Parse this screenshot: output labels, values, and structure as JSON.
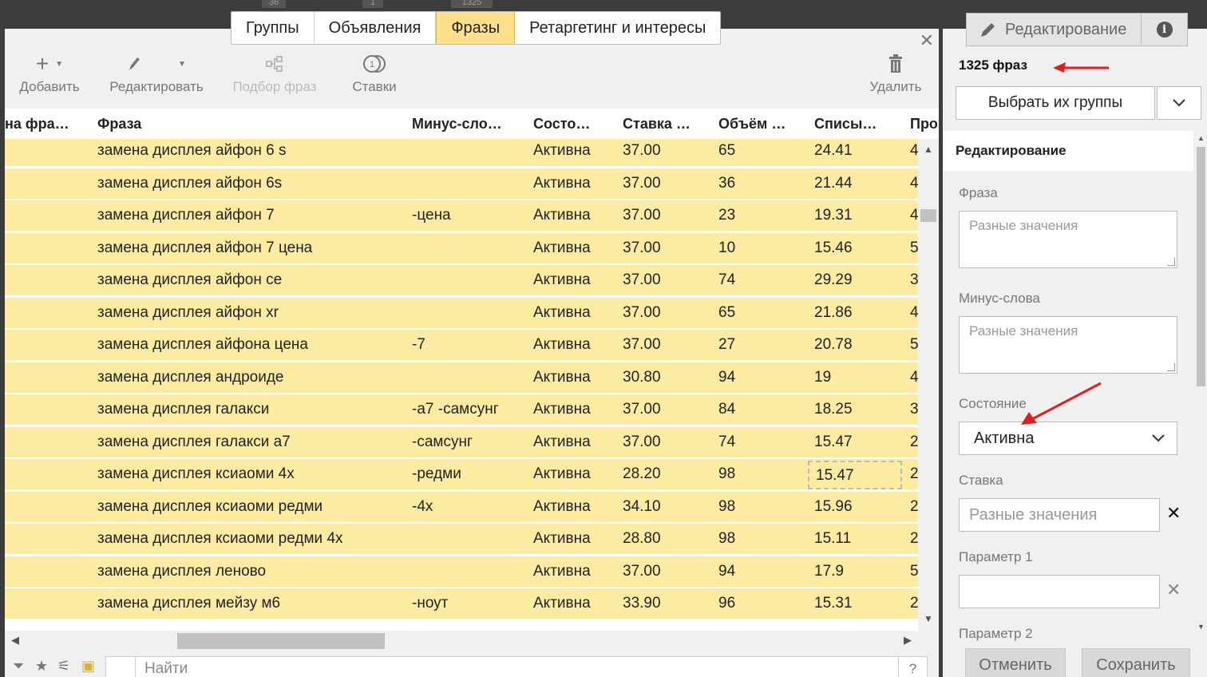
{
  "top_badges": [
    "36",
    "1",
    "1325"
  ],
  "tabs": [
    {
      "label": "Группы",
      "active": false
    },
    {
      "label": "Объявления",
      "active": false
    },
    {
      "label": "Фразы",
      "active": true
    },
    {
      "label": "Ретаргетинг и интересы",
      "active": false
    }
  ],
  "toolbar": {
    "add": "Добавить",
    "edit": "Редактировать",
    "pick": "Подбор фраз",
    "bids": "Ставки",
    "delete": "Удалить",
    "bids_icon_text": "1"
  },
  "columns": [
    "на фра…",
    "Фраза",
    "Минус-сло…",
    "Состо…",
    "Ставка …",
    "Объём …",
    "Списы…",
    "Про"
  ],
  "rows": [
    {
      "phrase": "замена дисплея айфон 6 s",
      "minus": "",
      "state": "Активна",
      "bid": "37.00",
      "volume": "65",
      "charge": "24.41",
      "extra": "4"
    },
    {
      "phrase": "замена дисплея айфон 6s",
      "minus": "",
      "state": "Активна",
      "bid": "37.00",
      "volume": "36",
      "charge": "21.44",
      "extra": "4"
    },
    {
      "phrase": "замена дисплея айфон 7",
      "minus": "-цена",
      "state": "Активна",
      "bid": "37.00",
      "volume": "23",
      "charge": "19.31",
      "extra": "4"
    },
    {
      "phrase": "замена дисплея айфон 7 цена",
      "minus": "",
      "state": "Активна",
      "bid": "37.00",
      "volume": "10",
      "charge": "15.46",
      "extra": "5"
    },
    {
      "phrase": "замена дисплея айфон се",
      "minus": "",
      "state": "Активна",
      "bid": "37.00",
      "volume": "74",
      "charge": "29.29",
      "extra": "3"
    },
    {
      "phrase": "замена дисплея айфон xr",
      "minus": "",
      "state": "Активна",
      "bid": "37.00",
      "volume": "65",
      "charge": "21.86",
      "extra": "4"
    },
    {
      "phrase": "замена дисплея айфона цена",
      "minus": "-7",
      "state": "Активна",
      "bid": "37.00",
      "volume": "27",
      "charge": "20.78",
      "extra": "5"
    },
    {
      "phrase": "замена дисплея андроиде",
      "minus": "",
      "state": "Активна",
      "bid": "30.80",
      "volume": "94",
      "charge": "19",
      "extra": "4"
    },
    {
      "phrase": "замена дисплея галакси",
      "minus": "-а7 -самсунг",
      "state": "Активна",
      "bid": "37.00",
      "volume": "84",
      "charge": "18.25",
      "extra": "3"
    },
    {
      "phrase": "замена дисплея галакси а7",
      "minus": "-самсунг",
      "state": "Активна",
      "bid": "37.00",
      "volume": "74",
      "charge": "15.47",
      "extra": "2"
    },
    {
      "phrase": "замена дисплея ксиаоми 4х",
      "minus": "-редми",
      "state": "Активна",
      "bid": "28.20",
      "volume": "98",
      "charge": "15.47",
      "extra": "2"
    },
    {
      "phrase": "замена дисплея ксиаоми редми",
      "minus": "-4х",
      "state": "Активна",
      "bid": "34.10",
      "volume": "98",
      "charge": "15.96",
      "extra": "2"
    },
    {
      "phrase": "замена дисплея ксиаоми редми 4х",
      "minus": "",
      "state": "Активна",
      "bid": "28.80",
      "volume": "98",
      "charge": "15.11",
      "extra": "2"
    },
    {
      "phrase": "замена дисплея леново",
      "minus": "",
      "state": "Активна",
      "bid": "37.00",
      "volume": "94",
      "charge": "17.9",
      "extra": "5"
    },
    {
      "phrase": "замена дисплея мейзу м6",
      "minus": "-ноут",
      "state": "Активна",
      "bid": "33.90",
      "volume": "96",
      "charge": "15.31",
      "extra": "2"
    }
  ],
  "search": {
    "placeholder": "Найти",
    "help": "?"
  },
  "right_panel": {
    "tab_edit": "Редактирование",
    "tab_info": "i",
    "count": "1325 фраз",
    "select_groups": "Выбрать их группы",
    "section_title": "Редактирование",
    "phrase_label": "Фраза",
    "phrase_placeholder": "Разные значения",
    "minus_label": "Минус-слова",
    "minus_placeholder": "Разные значения",
    "state_label": "Состояние",
    "state_value": "Активна",
    "bid_label": "Ставка",
    "bid_placeholder": "Разные значения",
    "param1_label": "Параметр 1",
    "param2_label": "Параметр 2",
    "cancel": "Отменить",
    "save": "Сохранить"
  },
  "colors": {
    "row_highlight": "#fdeba1",
    "active_tab": "#ffe08a",
    "annotation_arrow": "#e02020"
  }
}
